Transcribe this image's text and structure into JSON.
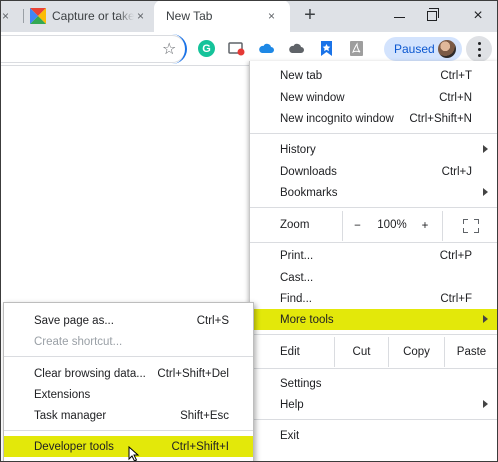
{
  "tabs": {
    "left_stub_close": "×",
    "capture_title": "Capture or take",
    "active_title": "New Tab",
    "close_glyph": "×",
    "new_tab": "+"
  },
  "toolbar": {
    "paused_label": "Paused",
    "grammarly_letter": "G"
  },
  "menu": {
    "new_tab": {
      "label": "New tab",
      "shortcut": "Ctrl+T"
    },
    "new_window": {
      "label": "New window",
      "shortcut": "Ctrl+N"
    },
    "new_incognito": {
      "label": "New incognito window",
      "shortcut": "Ctrl+Shift+N"
    },
    "history": {
      "label": "History"
    },
    "downloads": {
      "label": "Downloads",
      "shortcut": "Ctrl+J"
    },
    "bookmarks": {
      "label": "Bookmarks"
    },
    "zoom": {
      "label": "Zoom",
      "minus": "−",
      "value": "100%",
      "plus": "+"
    },
    "print": {
      "label": "Print...",
      "shortcut": "Ctrl+P"
    },
    "cast": {
      "label": "Cast..."
    },
    "find": {
      "label": "Find...",
      "shortcut": "Ctrl+F"
    },
    "more_tools": {
      "label": "More tools"
    },
    "edit": {
      "label": "Edit",
      "cut": "Cut",
      "copy": "Copy",
      "paste": "Paste"
    },
    "settings": {
      "label": "Settings"
    },
    "help": {
      "label": "Help"
    },
    "exit": {
      "label": "Exit"
    }
  },
  "submenu": {
    "save_page": {
      "label": "Save page as...",
      "shortcut": "Ctrl+S"
    },
    "create_shortcut": {
      "label": "Create shortcut..."
    },
    "clear_browsing": {
      "label": "Clear browsing data...",
      "shortcut": "Ctrl+Shift+Del"
    },
    "extensions": {
      "label": "Extensions"
    },
    "task_manager": {
      "label": "Task manager",
      "shortcut": "Shift+Esc"
    },
    "developer_tools": {
      "label": "Developer tools",
      "shortcut": "Ctrl+Shift+I"
    }
  },
  "colors": {
    "highlight": "#e3e80a",
    "paused_bg": "#d3e3fd",
    "tabstrip_bg": "#dee1e6"
  }
}
